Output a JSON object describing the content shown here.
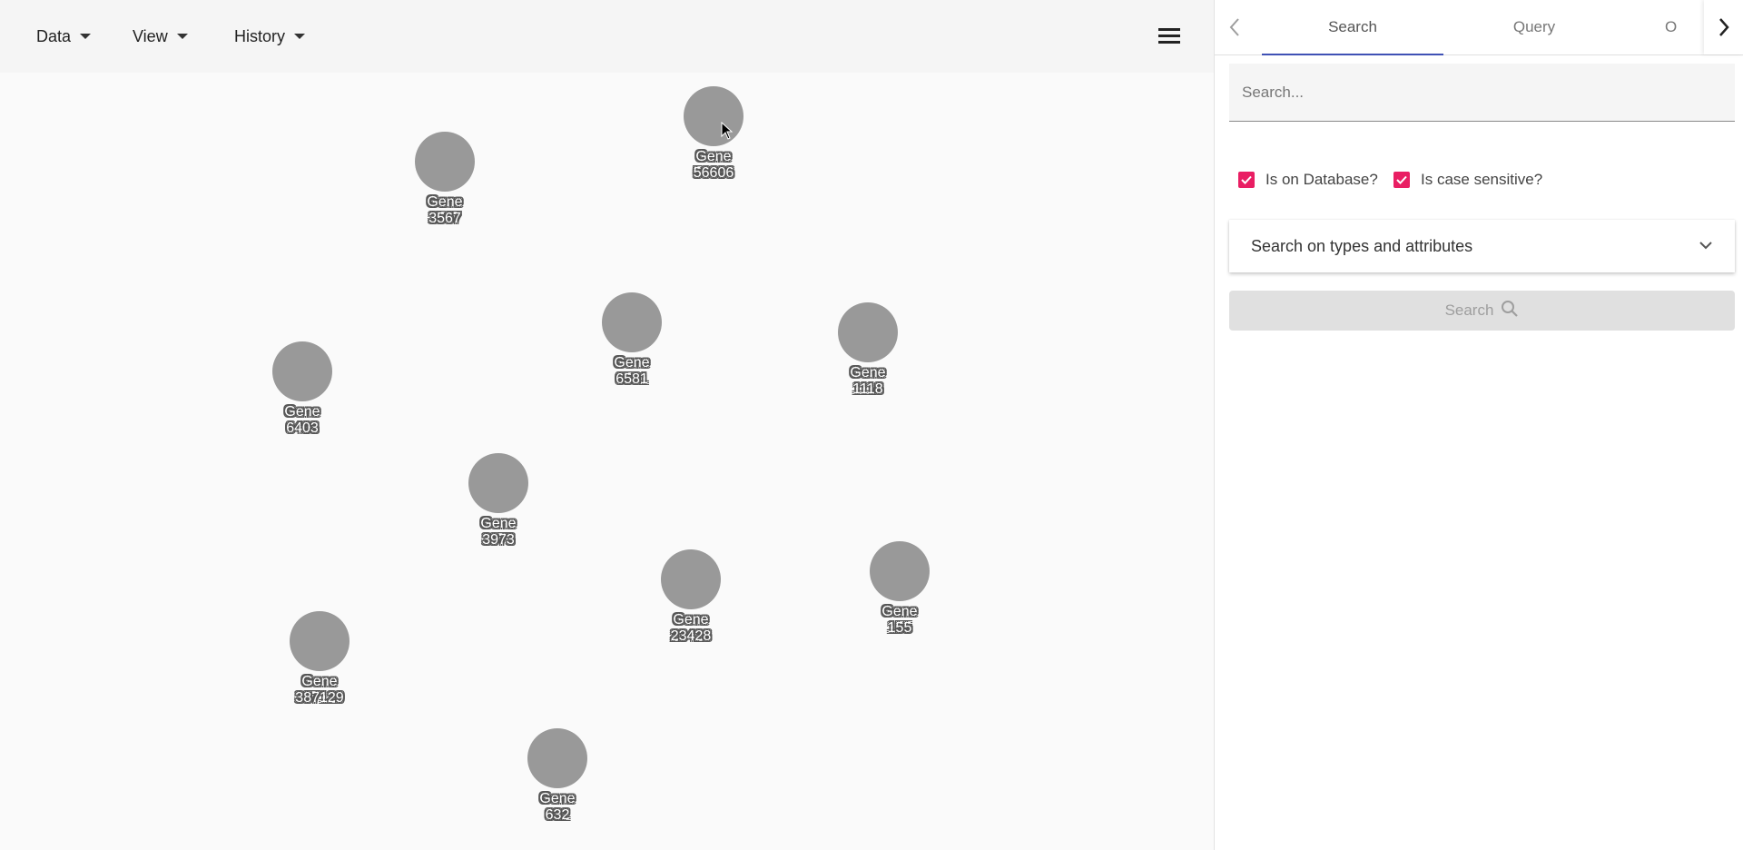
{
  "toolbar": {
    "menus": [
      {
        "label": "Data"
      },
      {
        "label": "View"
      },
      {
        "label": "History"
      }
    ],
    "hamburger_icon": "menu-icon"
  },
  "graph": {
    "node_color": "#999999",
    "label_outline_color": "#555555",
    "nodes": [
      {
        "line1": "Gene",
        "line2": "56606"
      },
      {
        "line1": "Gene",
        "line2": "3567"
      },
      {
        "line1": "Gene",
        "line2": "6581"
      },
      {
        "line1": "Gene",
        "line2": "1118"
      },
      {
        "line1": "Gene",
        "line2": "6403"
      },
      {
        "line1": "Gene",
        "line2": "3973"
      },
      {
        "line1": "Gene",
        "line2": "23428"
      },
      {
        "line1": "Gene",
        "line2": "155"
      },
      {
        "line1": "Gene",
        "line2": "387129"
      },
      {
        "line1": "Gene",
        "line2": "632"
      }
    ]
  },
  "panel": {
    "tabs": [
      {
        "label": "Search"
      },
      {
        "label": "Query"
      },
      {
        "label": "O"
      }
    ],
    "active_tab": "Search",
    "accent_color": "#3f51b5",
    "search": {
      "placeholder": "Search...",
      "value": ""
    },
    "options": [
      {
        "label": "Is on Database?",
        "checked": true
      },
      {
        "label": "Is case sensitive?",
        "checked": true
      }
    ],
    "checkbox_color": "#e91e63",
    "expansion_label": "Search on types and attributes",
    "search_button_label": "Search"
  }
}
